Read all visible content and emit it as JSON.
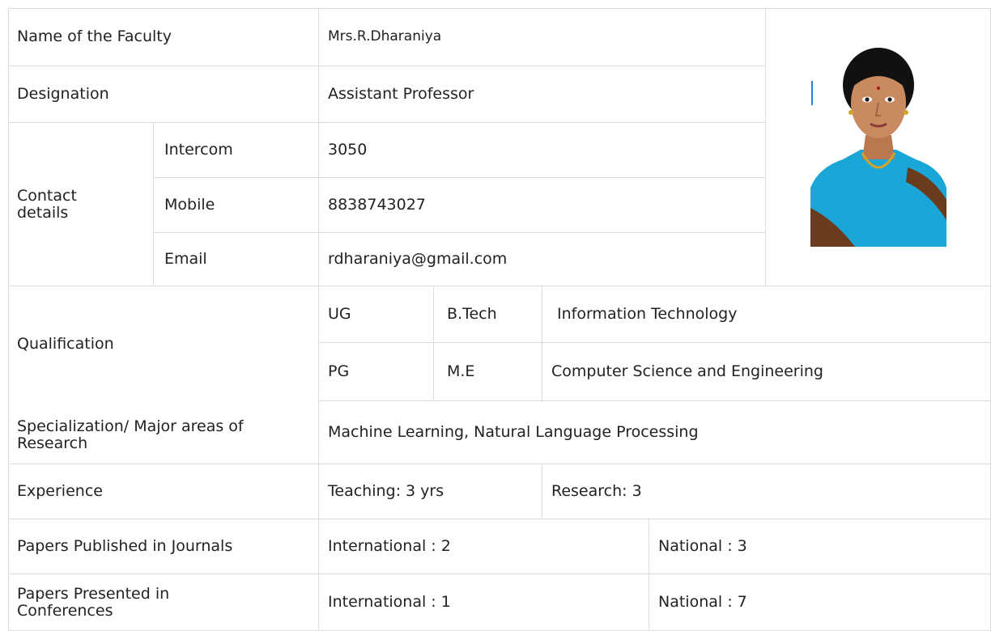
{
  "faculty": {
    "name_label": "Name of the Faculty",
    "name_value": "Mrs.R.Dharaniya",
    "designation_label": "Designation",
    "designation_value": "Assistant Professor",
    "contact_label": "Contact details",
    "intercom_label": "Intercom",
    "intercom_value": "3050",
    "mobile_label": "Mobile",
    "mobile_value": "8838743027",
    "email_label": "Email",
    "email_value": "rdharaniya@gmail.com"
  },
  "qualification": {
    "label": "Qualification",
    "ug_label": "UG",
    "ug_degree": "B.Tech",
    "ug_field": "Information Technology",
    "pg_label": "PG",
    "pg_degree": "M.E",
    "pg_field": "Computer Science and Engineering"
  },
  "specialization": {
    "label": "Specialization/ Major areas of Research",
    "value": "Machine Learning, Natural Language Processing"
  },
  "experience": {
    "label": "Experience",
    "teaching": "Teaching: 3 yrs",
    "research": "Research: 3"
  },
  "journals": {
    "label": "Papers Published in Journals",
    "international": "International : 2",
    "national": "National : 3"
  },
  "conferences": {
    "label": "Papers Presented in Conferences",
    "international": "International : 1",
    "national": "National : 7"
  },
  "colors": {
    "border": "#dcdcdc",
    "text": "#222222",
    "saree": "#1aa6d6",
    "skin": "#c98a5f"
  }
}
